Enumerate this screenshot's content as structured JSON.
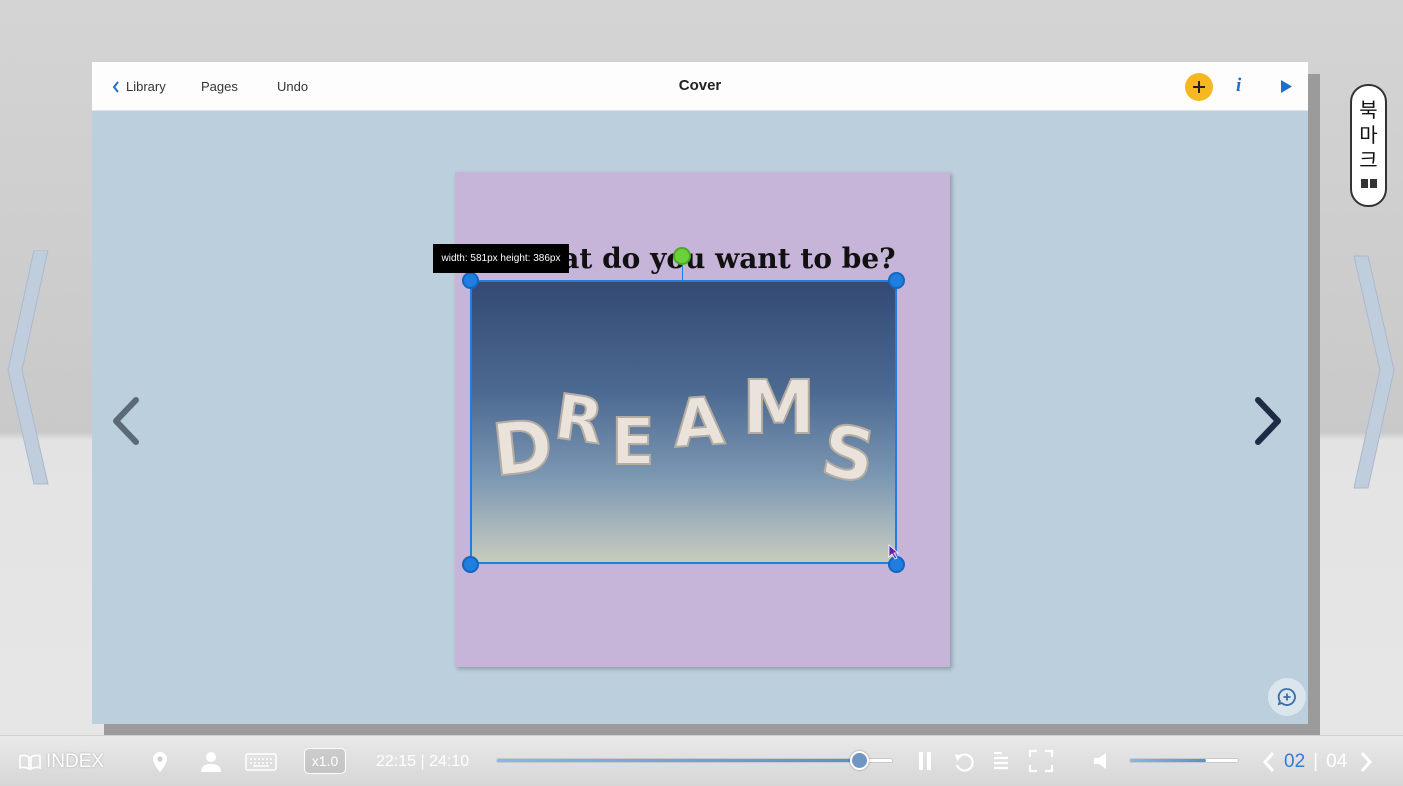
{
  "topbar": {
    "library_label": "Library",
    "pages_label": "Pages",
    "undo_label": "Undo",
    "title": "Cover"
  },
  "page": {
    "headline": "What do you want to be?",
    "selection_tooltip": "width: 581px height: 386px",
    "image_text": "DREAMS"
  },
  "bookmark": {
    "label_chars": [
      "북",
      "마",
      "크"
    ]
  },
  "bottombar": {
    "index_label": "INDEX",
    "speed_label": "x1.0",
    "time_label": "22:15 | 24:10",
    "progress": 0.92,
    "volume": 0.7,
    "current_page": "02",
    "separator": "|",
    "total_pages": "04"
  },
  "colors": {
    "accent": "#1f7ee0",
    "add_button": "#f6b81f",
    "rotate_handle": "#6bd13b",
    "canvas_bg": "#bccfdd",
    "page_bg": "#c6b5d8"
  },
  "icons": [
    "chevron-left-icon",
    "plus-icon",
    "info-icon",
    "play-icon",
    "prev-arrow-icon",
    "next-arrow-icon",
    "comment-add-icon",
    "book-icon",
    "location-pin-icon",
    "user-icon",
    "keyboard-icon",
    "pause-icon",
    "replay-icon",
    "list-icon",
    "fullscreen-icon",
    "speaker-icon"
  ]
}
